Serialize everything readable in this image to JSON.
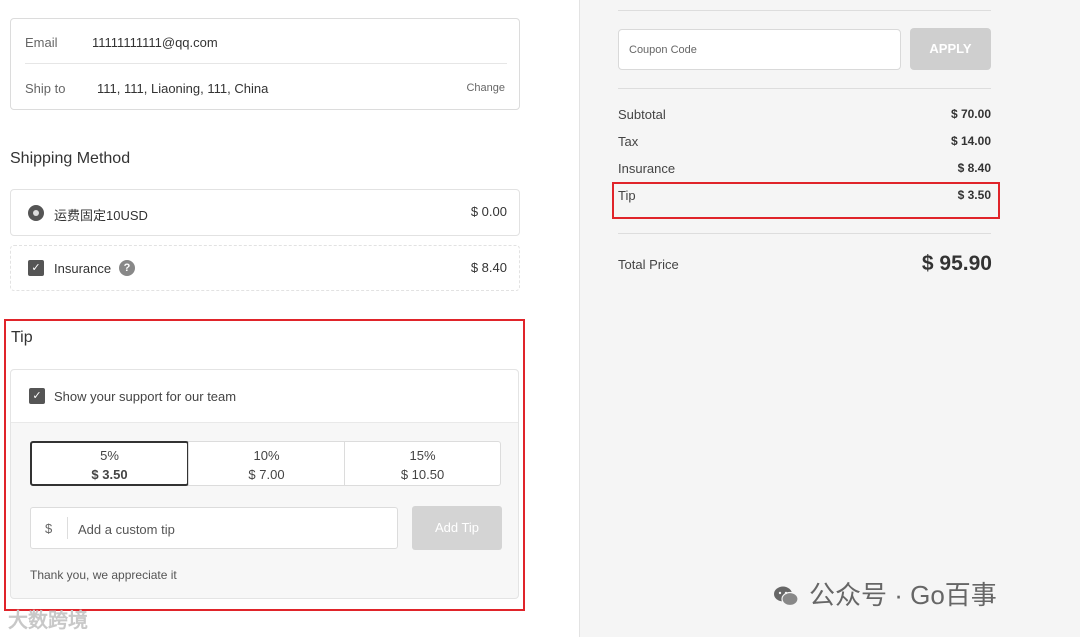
{
  "contact": {
    "email_label": "Email",
    "email_value": "11111111111@qq.com",
    "ship_label": "Ship to",
    "ship_value": "111, 111, Liaoning, 111, China",
    "change_label": "Change"
  },
  "shipping": {
    "title": "Shipping Method",
    "options": [
      {
        "label": "运费固定10USD",
        "price": "$ 0.00",
        "selected": true
      },
      {
        "label": "Insurance",
        "price": "$ 8.40",
        "checked": true
      }
    ]
  },
  "tip": {
    "title": "Tip",
    "support_label": "Show your support for our team",
    "percentages": [
      {
        "pct": "5%",
        "amount": "$ 3.50",
        "selected": true
      },
      {
        "pct": "10%",
        "amount": "$ 7.00"
      },
      {
        "pct": "15%",
        "amount": "$ 10.50"
      }
    ],
    "currency_symbol": "$",
    "custom_placeholder": "Add a custom tip",
    "add_label": "Add Tip",
    "thanks": "Thank you, we appreciate it"
  },
  "summary": {
    "coupon_placeholder": "Coupon Code",
    "apply_label": "APPLY",
    "rows": [
      {
        "label": "Subtotal",
        "value": "$ 70.00"
      },
      {
        "label": "Tax",
        "value": "$ 14.00"
      },
      {
        "label": "Insurance",
        "value": "$ 8.40"
      },
      {
        "label": "Tip",
        "value": "$ 3.50"
      }
    ],
    "total_label": "Total Price",
    "total_value": "$ 95.90"
  },
  "watermarks": {
    "wechat": "公众号 · Go百事",
    "brand": "大数跨境"
  },
  "colors": {
    "highlight": "#e0242a",
    "button_disabled": "#d4d4d4"
  }
}
